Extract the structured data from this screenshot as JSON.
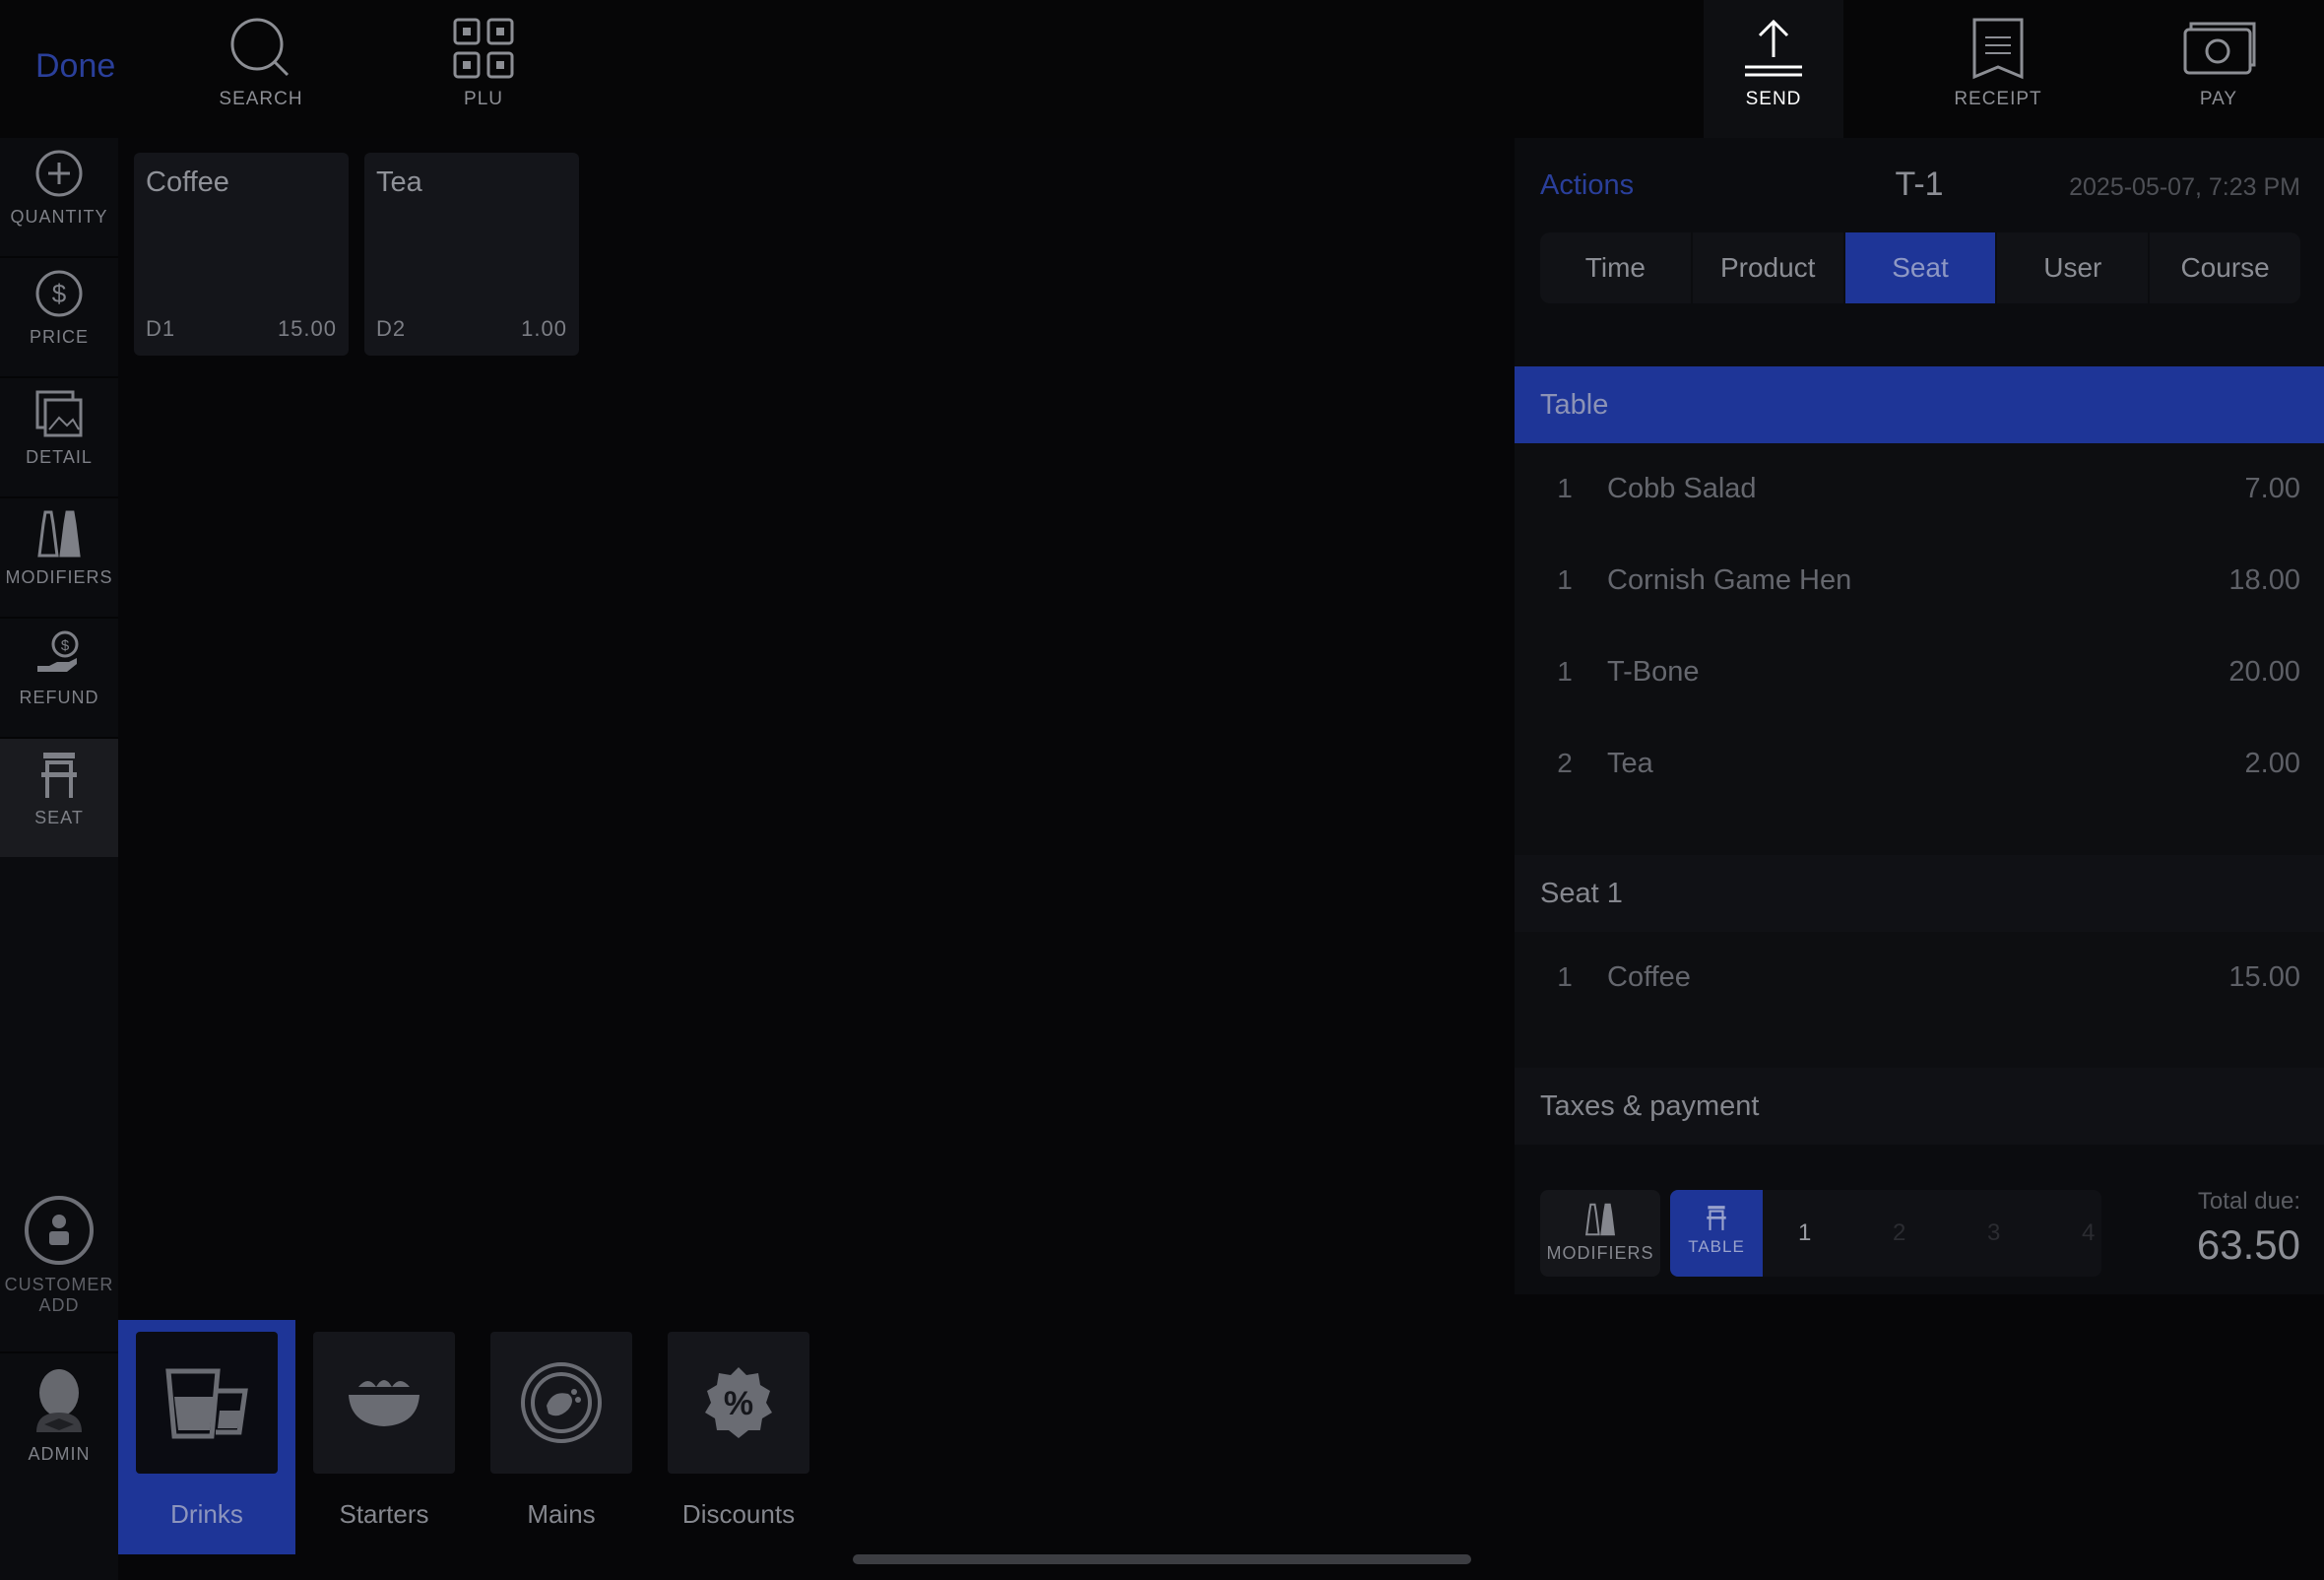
{
  "topbar": {
    "done_label": "Done",
    "search_label": "SEARCH",
    "plu_label": "PLU",
    "send_label": "SEND",
    "receipt_label": "RECEIPT",
    "pay_label": "PAY"
  },
  "rail": {
    "quantity": "QUANTITY",
    "price": "PRICE",
    "detail": "DETAIL",
    "modifiers": "MODIFIERS",
    "refund": "REFUND",
    "seat": "SEAT",
    "customer_line1": "CUSTOMER",
    "customer_line2": "ADD",
    "admin": "ADMIN"
  },
  "products": [
    {
      "name": "Coffee",
      "code": "D1",
      "price": "15.00"
    },
    {
      "name": "Tea",
      "code": "D2",
      "price": "1.00"
    }
  ],
  "panel": {
    "actions_label": "Actions",
    "title": "T-1",
    "datetime": "2025-05-07, 7:23 PM",
    "tabs": [
      "Time",
      "Product",
      "Seat",
      "User",
      "Course"
    ],
    "active_tab": "Seat",
    "table_header": "Table",
    "table_rows": [
      {
        "qty": "1",
        "item": "Cobb Salad",
        "amount": "7.00"
      },
      {
        "qty": "1",
        "item": "Cornish Game Hen",
        "amount": "18.00"
      },
      {
        "qty": "1",
        "item": "T-Bone",
        "amount": "20.00"
      },
      {
        "qty": "2",
        "item": "Tea",
        "amount": "2.00"
      }
    ],
    "seat_header": "Seat 1",
    "seat_rows": [
      {
        "qty": "1",
        "item": "Coffee",
        "amount": "15.00"
      }
    ],
    "taxes_header": "Taxes & payment",
    "footer": {
      "modifiers_label": "MODIFIERS",
      "table_label": "TABLE",
      "seat_numbers": [
        "1",
        "2",
        "3",
        "4"
      ],
      "total_label": "Total due:",
      "total_value": "63.50"
    }
  },
  "categories": [
    {
      "label": "Drinks",
      "icon": "drinks-icon"
    },
    {
      "label": "Starters",
      "icon": "salad-bowl-icon"
    },
    {
      "label": "Mains",
      "icon": "plate-icon"
    },
    {
      "label": "Discounts",
      "icon": "percent-badge-icon"
    }
  ],
  "colors": {
    "accent": "#1e3597",
    "background": "#060608",
    "panel": "#0b0c0f"
  }
}
